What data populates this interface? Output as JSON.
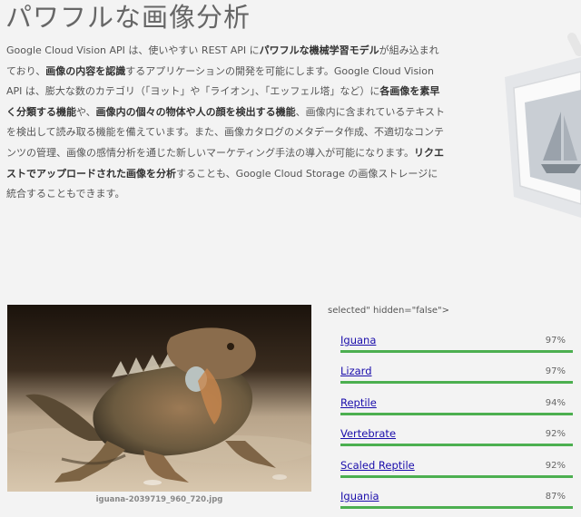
{
  "title": "パワフルな画像分析",
  "intro": [
    {
      "t": "Google Cloud Vision API は、使いやすい REST API に"
    },
    {
      "t": "パワフルな機械学習モデル",
      "b": true
    },
    {
      "t": "が組み込まれており、"
    },
    {
      "t": "画像の内容を認識",
      "b": true
    },
    {
      "t": "するアプリケーションの開発を可能にします。Google Cloud Vision API は、膨大な数のカテゴリ（「ヨット」や「ライオン」、「エッフェル塔」など）に"
    },
    {
      "t": "各画像を素早く分類する機能",
      "b": true
    },
    {
      "t": "や、"
    },
    {
      "t": "画像内の個々の物体や人の顔を検出する機能",
      "b": true
    },
    {
      "t": "、画像内に含まれているテキストを検出して読み取る機能を備えています。また、画像カタログのメタデータ作成、不適切なコンテンツの管理、画像の感情分析を通じた新しいマーケティング手法の導入が可能になります。"
    },
    {
      "t": "リクエストでアップロードされた画像を分析",
      "b": true
    },
    {
      "t": "することも、Google Cloud Storage の画像ストレージに統合することもできます。"
    }
  ],
  "image_caption": "iguana-2039719_960_720.jpg",
  "stray_markup_text": "selected\" hidden=\"false\">",
  "label_color": "#4caf50",
  "labels": [
    {
      "name": "Iguana",
      "score": "97%",
      "value": 0.97
    },
    {
      "name": "Lizard",
      "score": "97%",
      "value": 0.97
    },
    {
      "name": "Reptile",
      "score": "94%",
      "value": 0.94
    },
    {
      "name": "Vertebrate",
      "score": "92%",
      "value": 0.92
    },
    {
      "name": "Scaled Reptile",
      "score": "92%",
      "value": 0.92
    },
    {
      "name": "Iguania",
      "score": "87%",
      "value": 0.87
    }
  ]
}
